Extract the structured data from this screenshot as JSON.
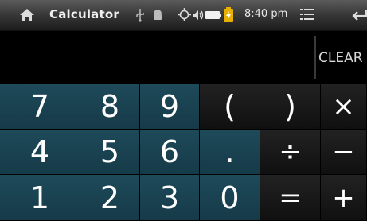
{
  "status_bar": {
    "app_title": "Calculator",
    "time": "8:40 pm",
    "icons": [
      "home-icon",
      "usb-icon",
      "android-icon",
      "gps-icon",
      "volume-icon",
      "battery-icon",
      "charging-icon",
      "notifications-icon",
      "back-icon"
    ]
  },
  "display": {
    "value": "",
    "clear_label": "CLEAR"
  },
  "keypad": {
    "keys": {
      "k7": "7",
      "k8": "8",
      "k9": "9",
      "lparen": "(",
      "rparen": ")",
      "multiply": "×",
      "k4": "4",
      "k5": "5",
      "k6": "6",
      "dot": ".",
      "divide": "÷",
      "minus": "−",
      "k1": "1",
      "k2": "2",
      "k3": "3",
      "k0": "0",
      "equals": "=",
      "plus": "+"
    }
  },
  "colors": {
    "digit_key": "#1e4a5a",
    "operator_key": "#181818",
    "status_bar": "#3a3a3a",
    "charge_icon": "#e8b000"
  }
}
